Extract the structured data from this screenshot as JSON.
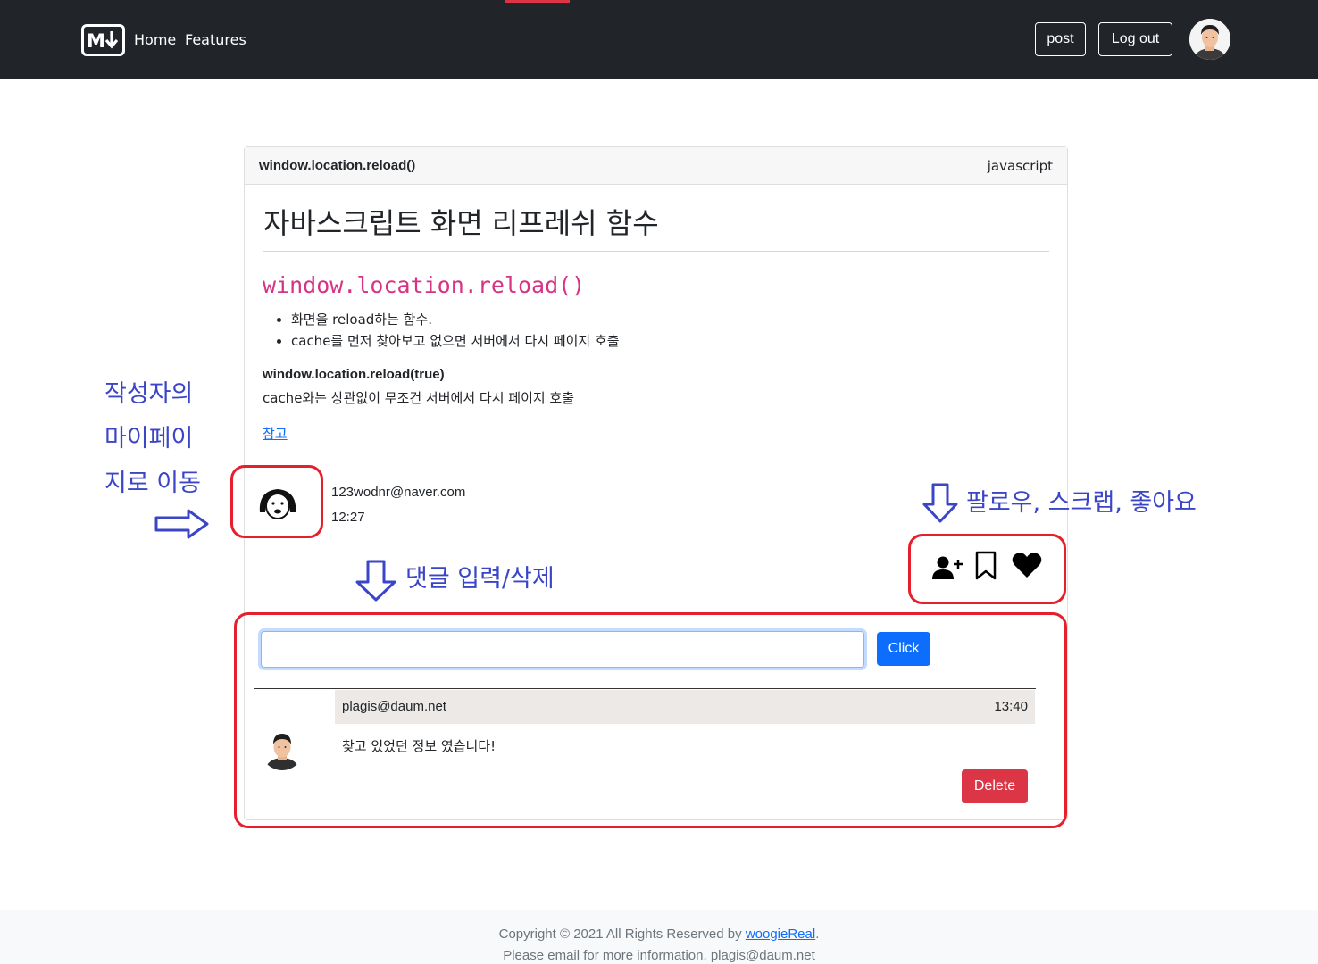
{
  "nav": {
    "links": [
      "Home",
      "Features"
    ],
    "post_button": "post",
    "logout_button": "Log out"
  },
  "post": {
    "header_title": "window.location.reload()",
    "language": "javascript",
    "title": "자바스크립트 화면 리프레쉬 함수",
    "code_heading": "window.location.reload()",
    "bullets": [
      "화면을 reload하는 함수.",
      "cache를 먼저 찾아보고 없으면 서버에서 다시 페이지 호출"
    ],
    "subheading": "window.location.reload(true)",
    "subheading_desc": "cache와는 상관없이 무조건 서버에서 다시 페이지 호출",
    "reference_link": "참고",
    "author_email": "123wodnr@naver.com",
    "time": "12:27"
  },
  "comment_form": {
    "input_value": "",
    "submit_button": "Click"
  },
  "comments": [
    {
      "author": "plagis@daum.net",
      "time": "13:40",
      "text": "찾고 있었던 정보 였습니다!",
      "delete_button": "Delete"
    }
  ],
  "annotations": {
    "mypage_line1": "작성자의",
    "mypage_line2": "마이페이",
    "mypage_line3": "지로 이동",
    "actions": "팔로우, 스크랩, 좋아요",
    "comments": "댓글 입력/삭제"
  },
  "footer": {
    "copyright_prefix": "Copyright © 2021 All Rights Reserved by ",
    "copyright_link": "woogieReal",
    "copyright_suffix": ".",
    "contact": "Please email for more information. plagis@daum.net"
  },
  "colors": {
    "navbar": "#212529",
    "primary": "#0d6efd",
    "danger": "#dc3545",
    "annotation_text": "#3a45c8",
    "annotation_box": "#e5202c",
    "code_pink": "#d63384"
  },
  "icons": [
    "markdown-logo-icon",
    "user-avatar-icon",
    "follow-icon",
    "bookmark-icon",
    "heart-icon",
    "arrow-right-icon",
    "arrow-down-icon"
  ]
}
